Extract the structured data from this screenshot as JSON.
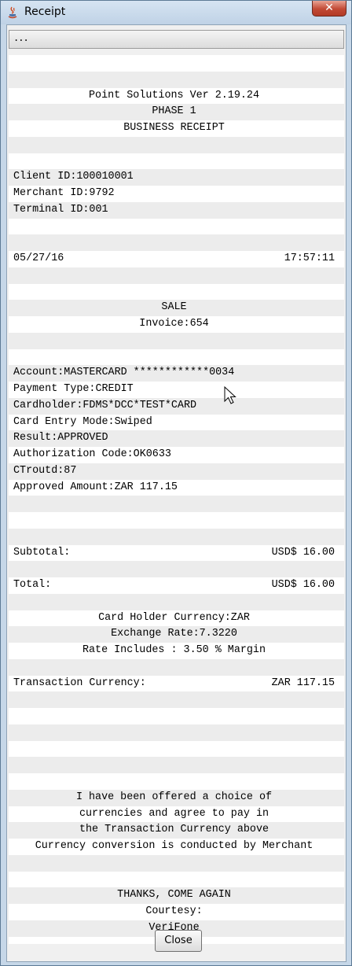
{
  "window": {
    "title": "Receipt",
    "close_glyph": "✕"
  },
  "toolbar": {
    "label": "..."
  },
  "receipt": {
    "header": {
      "product": "Point Solutions Ver 2.19.24",
      "phase": "PHASE 1",
      "type": "BUSINESS RECEIPT"
    },
    "ids": {
      "client": "Client ID:100010001",
      "merchant": "Merchant ID:9792",
      "terminal": "Terminal ID:001"
    },
    "date": "05/27/16",
    "time": "17:57:11",
    "transaction": {
      "kind": "SALE",
      "invoice": "Invoice:654"
    },
    "details": {
      "account": "Account:MASTERCARD ************0034",
      "payment_type": "Payment Type:CREDIT",
      "cardholder": "Cardholder:FDMS*DCC*TEST*CARD",
      "entry_mode": "Card Entry Mode:Swiped",
      "result": "Result:APPROVED",
      "auth_code": "Authorization Code:OK0633",
      "ctroutd": "CTroutd:87",
      "approved_amount": "Approved Amount:ZAR 117.15"
    },
    "subtotal": {
      "label": "Subtotal:",
      "value": "USD$ 16.00"
    },
    "total": {
      "label": "Total:",
      "value": "USD$ 16.00"
    },
    "currency": {
      "holder_currency": "Card Holder Currency:ZAR",
      "exchange_rate": "Exchange Rate:7.3220",
      "margin": "Rate Includes : 3.50 % Margin"
    },
    "transaction_currency": {
      "label": "Transaction Currency:",
      "value": "ZAR 117.15"
    },
    "disclaimer": [
      "I have been offered a choice of",
      "currencies and agree to pay in",
      "the Transaction Currency above",
      "Currency conversion is conducted by Merchant"
    ],
    "footer": {
      "thanks": "THANKS, COME AGAIN",
      "courtesy": "Courtesy:",
      "vendor": "VeriFone"
    }
  },
  "buttons": {
    "close": "Close"
  }
}
